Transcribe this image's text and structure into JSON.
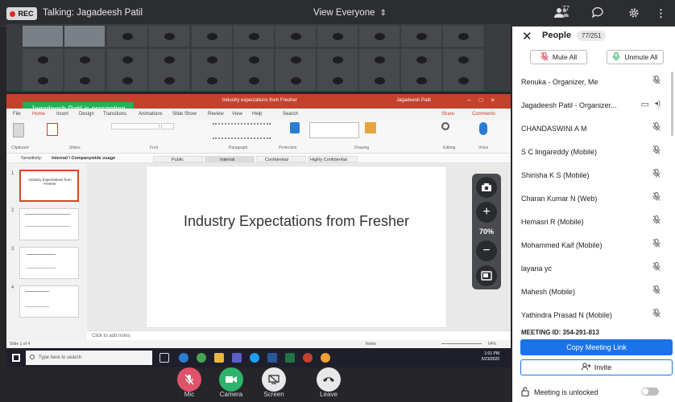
{
  "topbar": {
    "rec_label": "REC",
    "talking": "Talking: Jagadeesh Patil",
    "view_mode": "View Everyone",
    "people_count": "77"
  },
  "presenter_banner": "Jagadeesh Patil is presenting",
  "ppt": {
    "window_title": "Industry expectations from Fresher",
    "user": "Jagadeesh Patil",
    "tabs": [
      "File",
      "Home",
      "Insert",
      "Design",
      "Transitions",
      "Animations",
      "Slide Show",
      "Review",
      "View",
      "Help",
      "Search"
    ],
    "share": "Share",
    "comments": "Comments",
    "groups": [
      "Clipboard",
      "Slides",
      "Font",
      "Paragraph",
      "Protection",
      "Drawing",
      "Editing",
      "Voice"
    ],
    "sensitivity": "Sensitivity:",
    "sensitivity_value": "Internal \\ Companywide usage",
    "sens_levels": [
      "Public",
      "Internal",
      "Confidential",
      "Highly Confidential"
    ],
    "slide_title": "Industry Expectations from Fresher",
    "thumb1_text": "Industry Expectations from Fresher",
    "notes_placeholder": "Click to add notes",
    "status_left": "Slide 1 of 4",
    "notes_btn": "Notes",
    "zoom_status": "64%"
  },
  "taskbar": {
    "search_placeholder": "Type here to search",
    "time": "1:01 PM",
    "date": "5/23/2020"
  },
  "zoom": {
    "level": "70%"
  },
  "controls": {
    "mic": "Mic",
    "camera": "Camera",
    "screen": "Screen",
    "leave": "Leave"
  },
  "panel": {
    "title": "People",
    "count": "77/251",
    "mute_all": "Mute All",
    "unmute_all": "Unmute All",
    "participants": [
      "Renuka - Organizer, Me",
      "Jagadeesh Patil - Organizer...",
      "CHANDASWINI A M",
      "S C lingareddy (Mobile)",
      "Shirisha K S (Mobile)",
      "Charan Kumar N (Web)",
      "Hemasri R (Mobile)",
      "Mohammed Kaif (Mobile)",
      "layana yc",
      "Mahesh (Mobile)",
      "Yathindra Prasad N (Mobile)"
    ],
    "meeting_id": "MEETING ID: 354-291-813",
    "copy_link": "Copy Meeting Link",
    "invite": "Invite",
    "lock_status": "Meeting is unlocked"
  },
  "colors": {
    "accent": "#1a73e8",
    "ppt_red": "#c4412b",
    "presenting_green": "#20b15a",
    "mic_red": "#e0526a",
    "camera_green": "#2fb26b",
    "leave_grey": "#e8e8e8"
  }
}
